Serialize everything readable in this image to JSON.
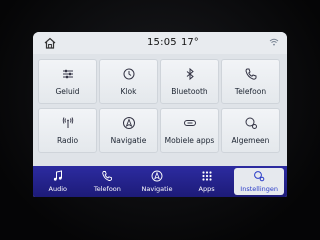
{
  "status": {
    "time": "15:05",
    "temperature": "17°"
  },
  "tiles": [
    {
      "label": "Geluid",
      "icon": "sliders-icon"
    },
    {
      "label": "Klok",
      "icon": "clock-icon"
    },
    {
      "label": "Bluetooth",
      "icon": "bluetooth-icon"
    },
    {
      "label": "Telefoon",
      "icon": "phone-icon"
    },
    {
      "label": "Radio",
      "icon": "radio-antenna-icon"
    },
    {
      "label": "Navigatie",
      "icon": "navigation-icon"
    },
    {
      "label": "Mobiele apps",
      "icon": "mobile-apps-icon"
    },
    {
      "label": "Algemeen",
      "icon": "settings-icon"
    }
  ],
  "pager": {
    "pages": 3,
    "current": 1
  },
  "nav": [
    {
      "label": "Audio",
      "icon": "music-note-icon"
    },
    {
      "label": "Telefoon",
      "icon": "phone-icon"
    },
    {
      "label": "Navigatie",
      "icon": "navigation-icon"
    },
    {
      "label": "Apps",
      "icon": "apps-grid-icon"
    },
    {
      "label": "Instellingen",
      "icon": "settings-icon",
      "active": true
    }
  ],
  "colors": {
    "nav_bar": "#221f8c",
    "accent": "#2f64e0",
    "screen_bg": "#dfe3e8"
  }
}
